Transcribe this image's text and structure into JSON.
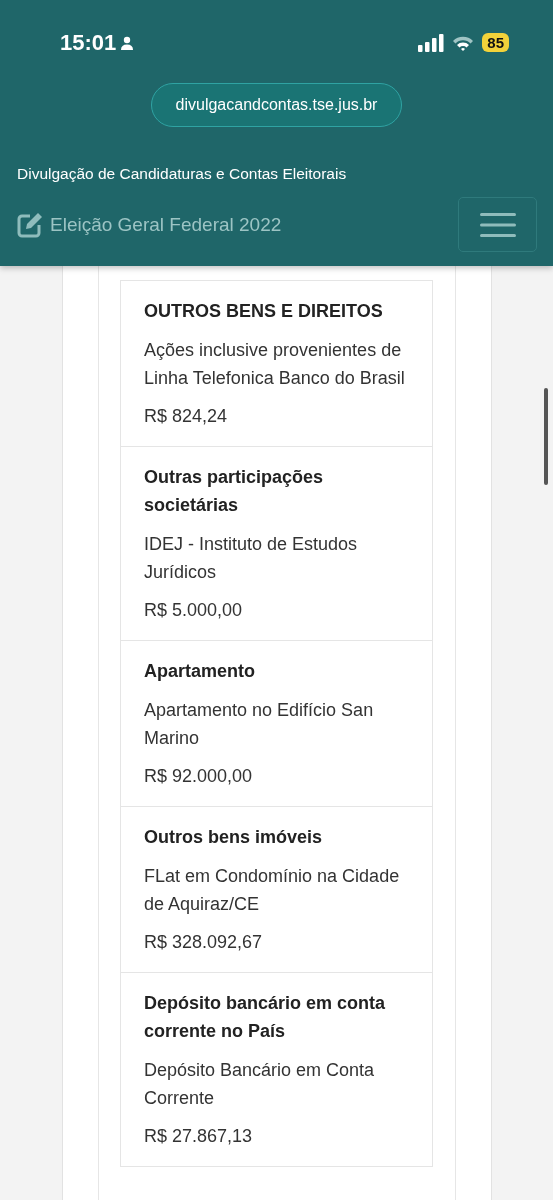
{
  "status_bar": {
    "time": "15:01",
    "battery": "85"
  },
  "browser": {
    "url": "divulgacandcontas.tse.jus.br"
  },
  "header": {
    "title": "Divulgação de Candidaturas e Contas Eleitorais",
    "election": "Eleição Geral Federal 2022"
  },
  "assets": [
    {
      "type": "OUTROS BENS E DIREITOS",
      "description": "Ações inclusive provenientes de Linha Telefonica Banco do Brasil",
      "value": "R$ 824,24"
    },
    {
      "type": "Outras participações societárias",
      "description": "IDEJ - Instituto de Estudos Jurídicos",
      "value": "R$ 5.000,00"
    },
    {
      "type": "Apartamento",
      "description": "Apartamento no Edifício San Marino",
      "value": "R$ 92.000,00"
    },
    {
      "type": "Outros bens imóveis",
      "description": "FLat em Condomínio na Cidade de Aquiraz/CE",
      "value": "R$ 328.092,67"
    },
    {
      "type": "Depósito bancário em conta corrente no País",
      "description": "Depósito Bancário em Conta Corrente",
      "value": "R$ 27.867,13"
    }
  ]
}
